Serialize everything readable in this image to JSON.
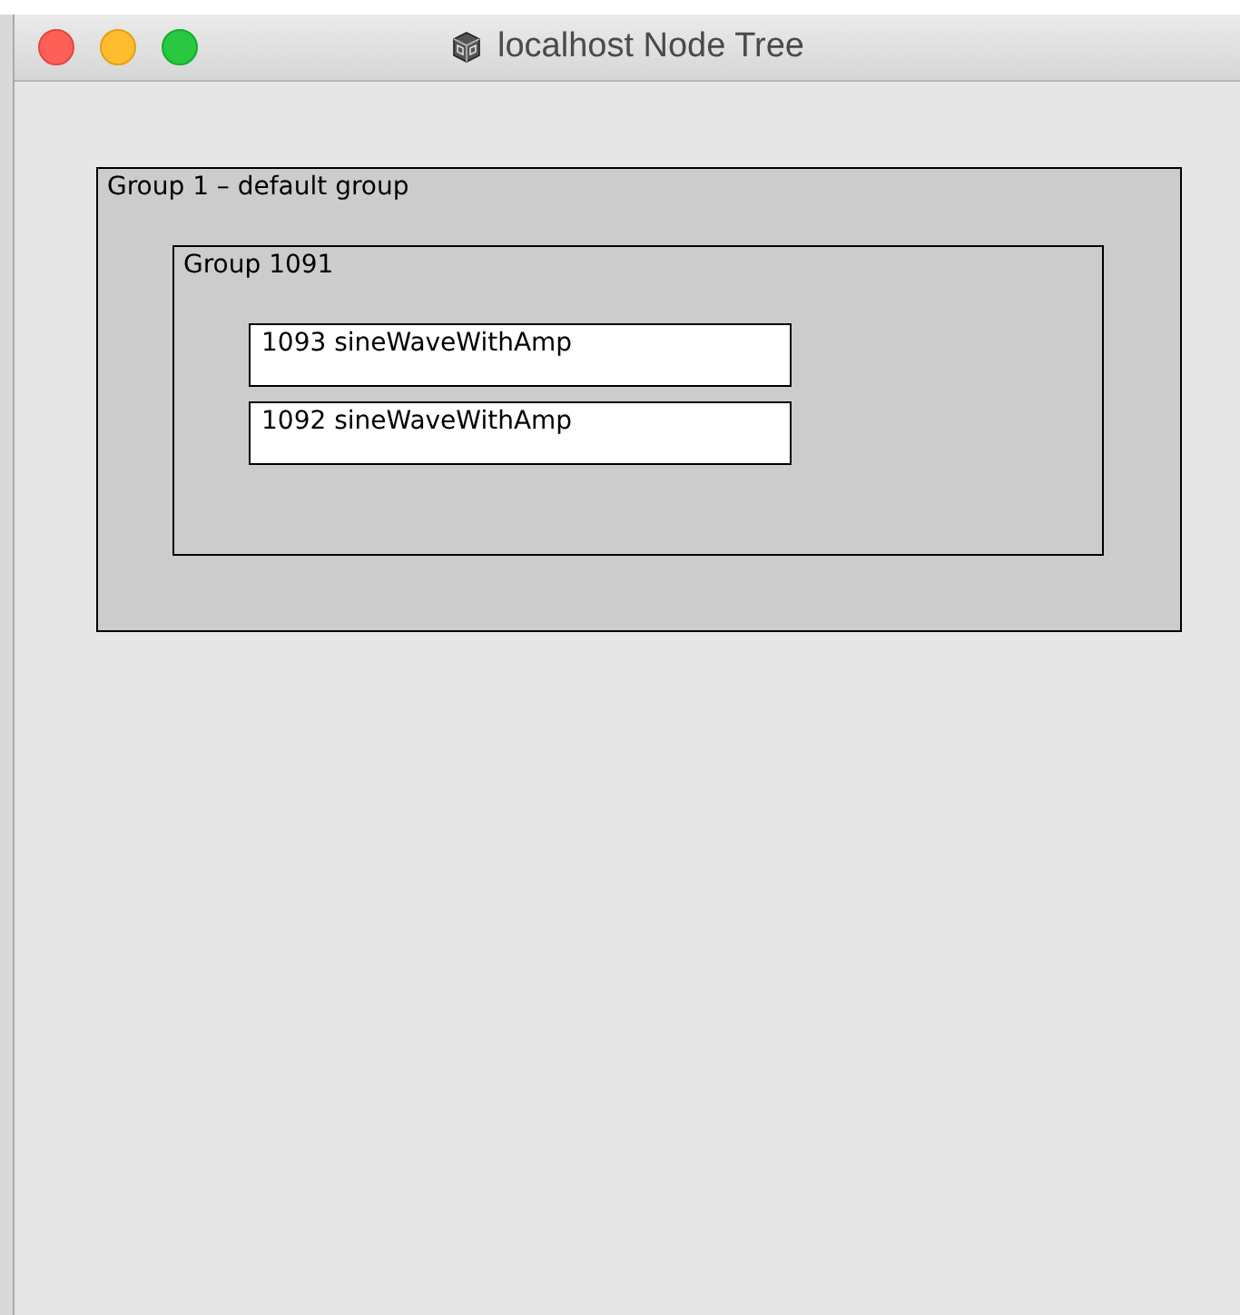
{
  "window": {
    "title": "localhost Node Tree"
  },
  "tree": [
    {
      "kind": "group",
      "label": "Group 1 – default group",
      "children": [
        {
          "kind": "group",
          "label": "Group 1091",
          "children": [
            {
              "kind": "synth",
              "label": "1093 sineWaveWithAmp"
            },
            {
              "kind": "synth",
              "label": "1092 sineWaveWithAmp"
            }
          ]
        }
      ]
    }
  ]
}
